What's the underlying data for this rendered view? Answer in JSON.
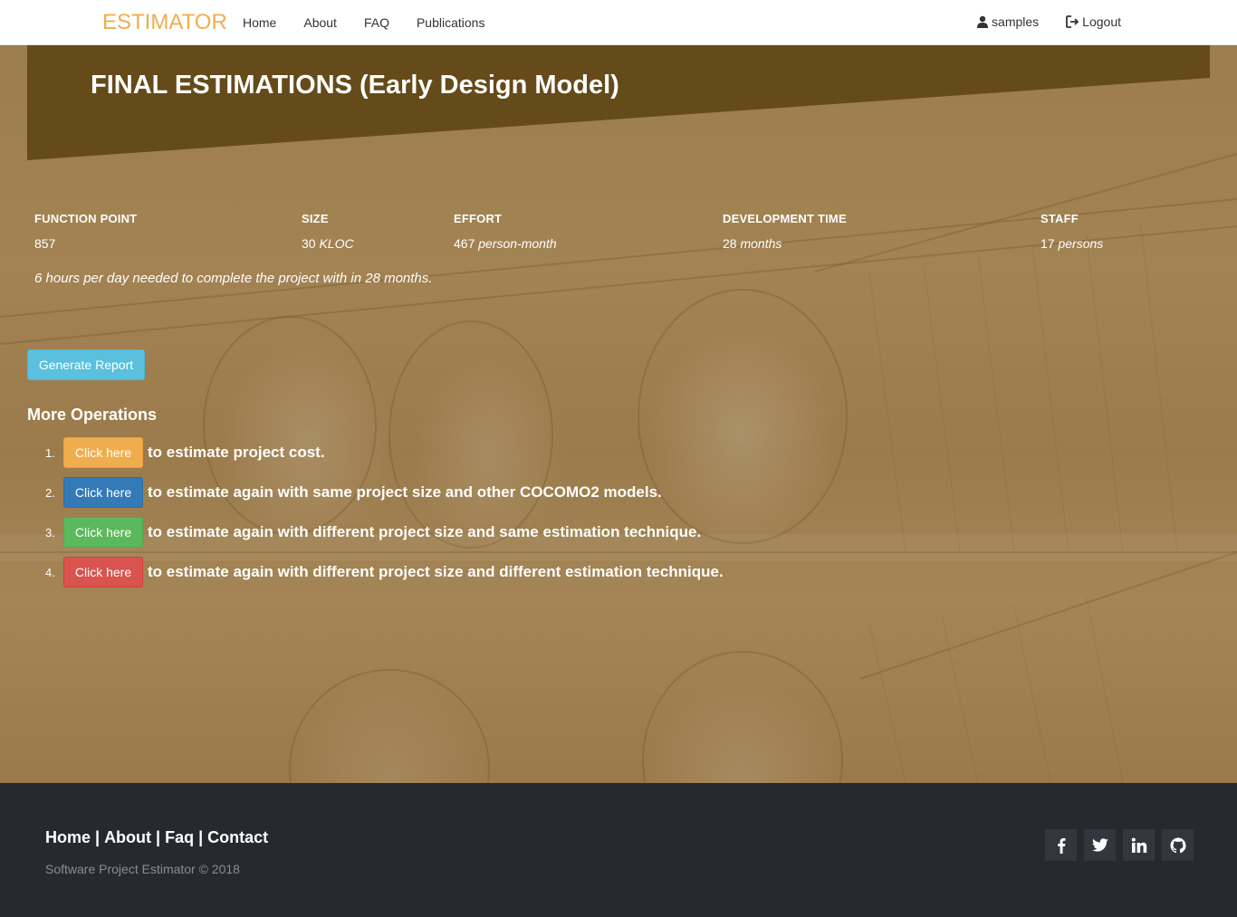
{
  "brand": {
    "name": "ESTIMATOR",
    "color": "#f0ad4e"
  },
  "nav": {
    "links": [
      "Home",
      "About",
      "FAQ",
      "Publications"
    ],
    "user": "samples",
    "logout": "Logout"
  },
  "page": {
    "title": "FINAL ESTIMATIONS (Early Design Model)"
  },
  "stats": [
    {
      "label": "FUNCTION POINT",
      "value": "857",
      "unit": ""
    },
    {
      "label": "SIZE",
      "value": "30",
      "unit": "KLOC"
    },
    {
      "label": "EFFORT",
      "value": "467",
      "unit": "person-month"
    },
    {
      "label": "DEVELOPMENT TIME",
      "value": "28",
      "unit": "months"
    },
    {
      "label": "STAFF",
      "value": "17",
      "unit": "persons"
    }
  ],
  "note": "6 hours per day needed to complete the project with in 28 months.",
  "report_button": "Generate Report",
  "more": {
    "title": "More Operations",
    "items": [
      {
        "num": "1.",
        "button": "Click here",
        "text": "to estimate project cost.",
        "color": "#f0ad4e"
      },
      {
        "num": "2.",
        "button": "Click here",
        "text": "to estimate again with same project size and other COCOMO2 models.",
        "color": "#337ab7"
      },
      {
        "num": "3.",
        "button": "Click here",
        "text": "to estimate again with different project size and same estimation technique.",
        "color": "#5cb85c"
      },
      {
        "num": "4.",
        "button": "Click here",
        "text": "to estimate again with different project size and different estimation technique.",
        "color": "#d9534f"
      }
    ]
  },
  "footer": {
    "links": [
      "Home",
      "About",
      "Faq",
      "Contact"
    ],
    "copyright": "Software Project Estimator © 2018",
    "social": [
      "facebook-icon",
      "twitter-icon",
      "linkedin-icon",
      "github-icon"
    ]
  },
  "colors": {
    "banner": "#654a1a",
    "footer": "#262a2f"
  }
}
